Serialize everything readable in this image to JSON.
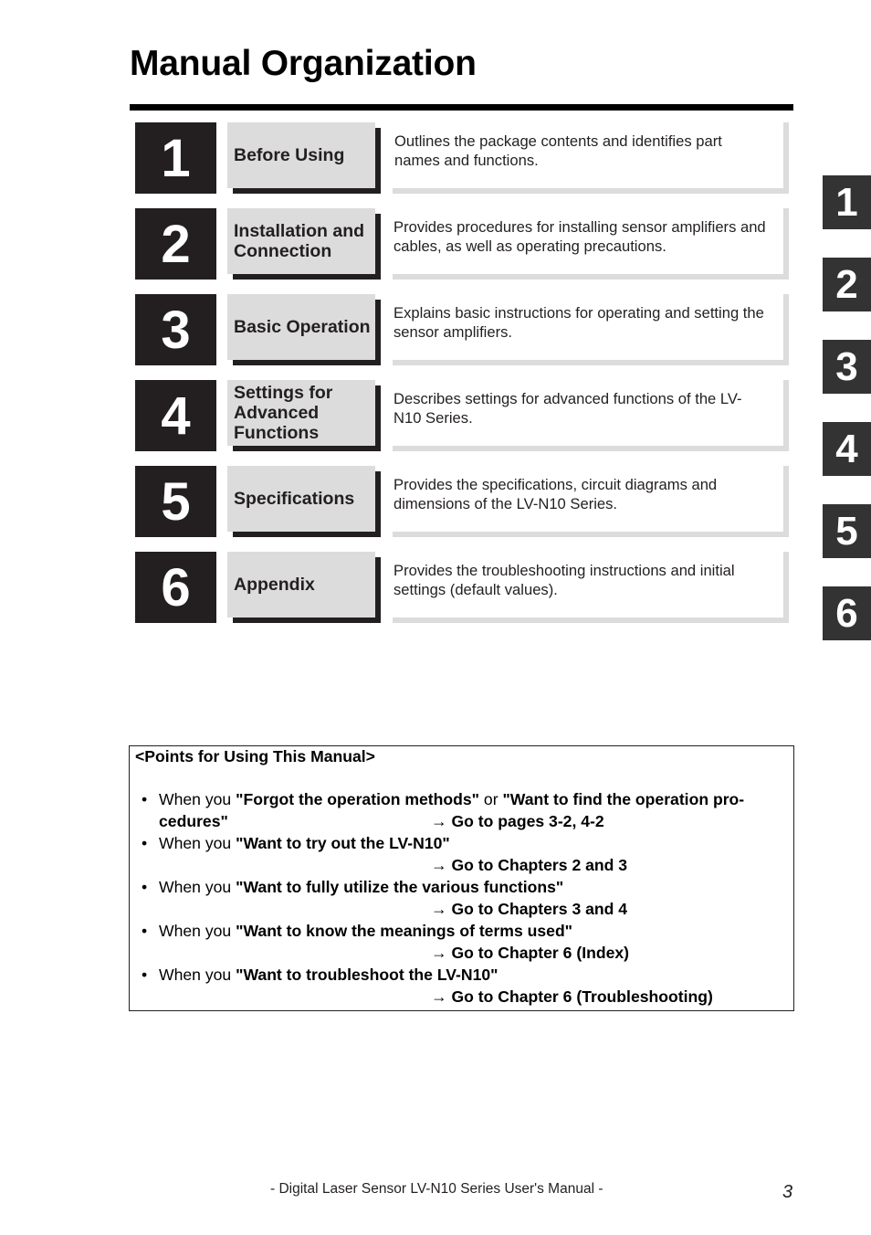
{
  "page": {
    "title": "Manual Organization"
  },
  "chapters": [
    {
      "number": "1",
      "title": "Before Using",
      "description": "Outlines the package contents and identifies part names and functions."
    },
    {
      "number": "2",
      "title": "Installation and Connection",
      "description": "Provides procedures for installing sensor amplifiers and cables, as well as operating precautions."
    },
    {
      "number": "3",
      "title": "Basic Operation",
      "description": "Explains basic instructions for operating and setting the sensor amplifiers."
    },
    {
      "number": "4",
      "title": "Settings for Advanced Functions",
      "description": "Describes settings for advanced functions of the LV-N10 Series."
    },
    {
      "number": "5",
      "title": "Specifications",
      "description": "Provides the specifications, circuit diagrams and dimensions of the LV-N10 Series."
    },
    {
      "number": "6",
      "title": "Appendix",
      "description": "Provides the troubleshooting instructions and initial settings (default values)."
    }
  ],
  "side_tabs": [
    "1",
    "2",
    "3",
    "4",
    "5",
    "6"
  ],
  "points": {
    "heading": "<Points for Using This Manual>",
    "bullet": "•",
    "items": [
      {
        "prefix": "When you ",
        "quote": "\"Forgot the operation methods\"",
        "middle": " or ",
        "quote2": "\"Want to find the operation pro-",
        "continuation": "cedures\"",
        "goto": "→ Go to pages 3-2, 4-2"
      },
      {
        "prefix": "When you ",
        "quote": "\"Want to try out the LV-N10\"",
        "goto": "→ Go to Chapters 2 and 3"
      },
      {
        "prefix": "When you ",
        "quote": "\"Want to fully utilize the various functions\"",
        "goto": "→ Go to Chapters 3 and 4"
      },
      {
        "prefix": "When you ",
        "quote": "\"Want to know the meanings of terms used\"",
        "goto": "→ Go to Chapter 6 (Index)"
      },
      {
        "prefix": "When you ",
        "quote": "\"Want to troubleshoot the LV-N10\"",
        "goto": "→ Go to Chapter 6 (Troubleshooting)"
      }
    ]
  },
  "footer": {
    "text": "- Digital Laser Sensor LV-N10 Series User's Manual -",
    "page_number": "3"
  },
  "colors": {
    "number_box": "#231f20",
    "title_box": "#dcdcdc",
    "side_tab": "#333333"
  }
}
